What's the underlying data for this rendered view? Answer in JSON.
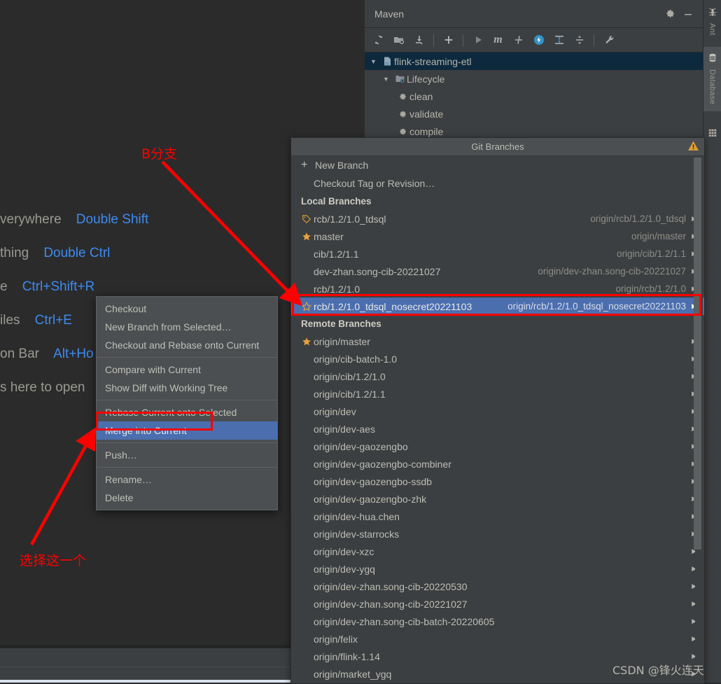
{
  "editor": {
    "hints": [
      {
        "label": "verywhere",
        "key": "Double Shift"
      },
      {
        "label": "thing",
        "key": "Double Ctrl"
      },
      {
        "label": "e",
        "key": "Ctrl+Shift+R"
      },
      {
        "label": "iles",
        "key": "Ctrl+E"
      },
      {
        "label": "on Bar",
        "key": "Alt+Ho"
      },
      {
        "label": "s here to open",
        "key": ""
      }
    ]
  },
  "maven": {
    "title": "Maven",
    "header_buttons": [
      {
        "name": "settings",
        "glyph": "⚙"
      },
      {
        "name": "hide",
        "glyph": "—"
      }
    ],
    "toolbar": [
      {
        "name": "reload-all-maven-projects-icon",
        "glyph": "↻"
      },
      {
        "name": "generate-sources-icon",
        "glyph": "◱"
      },
      {
        "name": "download-sources-icon",
        "glyph": "⤓"
      },
      {
        "name": "separator",
        "glyph": ""
      },
      {
        "name": "add-maven-project-icon",
        "glyph": "+"
      },
      {
        "name": "separator",
        "glyph": ""
      },
      {
        "name": "run-icon",
        "glyph": "▶"
      },
      {
        "name": "execute-maven-goal-icon",
        "glyph": "m"
      },
      {
        "name": "toggle-skip-tests-icon",
        "glyph": "∤"
      },
      {
        "name": "toggle-offline-mode-icon",
        "glyph": "⚡"
      },
      {
        "name": "expand-all-icon",
        "glyph": "⇕"
      },
      {
        "name": "collapse-all-icon",
        "glyph": "↕"
      },
      {
        "name": "separator",
        "glyph": ""
      },
      {
        "name": "maven-settings-icon",
        "glyph": "🔧"
      }
    ],
    "tree": [
      {
        "label": "flink-streaming-etl",
        "indent": 0,
        "selected": true,
        "triangle": "▼",
        "icon": "maven-module-icon"
      },
      {
        "label": "Lifecycle",
        "indent": 1,
        "selected": false,
        "triangle": "▼",
        "icon": "lifecycle-folder-icon"
      },
      {
        "label": "clean",
        "indent": 2,
        "selected": false,
        "triangle": "",
        "icon": "gear-icon"
      },
      {
        "label": "validate",
        "indent": 2,
        "selected": false,
        "triangle": "",
        "icon": "gear-icon"
      },
      {
        "label": "compile",
        "indent": 2,
        "selected": false,
        "triangle": "",
        "icon": "gear-icon"
      }
    ]
  },
  "tool_strip": [
    {
      "label": "Ant",
      "icon": "ant-icon",
      "active": false
    },
    {
      "label": "Database",
      "icon": "database-icon",
      "active": true
    },
    {
      "label": "",
      "icon": "grid-icon",
      "active": false
    }
  ],
  "git_branches": {
    "title": "Git Branches",
    "warning_icon": "warning-triangle-icon",
    "actions": [
      {
        "label": "New Branch",
        "icon": "plus-icon"
      },
      {
        "label": "Checkout Tag or Revision…",
        "icon": ""
      }
    ],
    "local_section": "Local Branches",
    "local": [
      {
        "name": "rcb/1.2/1.0_tdsql",
        "tracking": "origin/rcb/1.2/1.0_tdsql",
        "icon": "tag-icon",
        "selected": false
      },
      {
        "name": "master",
        "tracking": "origin/master",
        "icon": "star-filled-icon",
        "selected": false
      },
      {
        "name": "cib/1.2/1.1",
        "tracking": "origin/cib/1.2/1.1",
        "icon": "",
        "selected": false
      },
      {
        "name": "dev-zhan.song-cib-20221027",
        "tracking": "origin/dev-zhan.song-cib-20221027",
        "icon": "",
        "selected": false
      },
      {
        "name": "rcb/1.2/1.0",
        "tracking": "origin/rcb/1.2/1.0",
        "icon": "",
        "selected": false
      },
      {
        "name": "rcb/1.2/1.0_tdsql_nosecret20221103",
        "tracking": "origin/rcb/1.2/1.0_tdsql_nosecret20221103",
        "icon": "star-outline-icon",
        "selected": true
      }
    ],
    "remote_section": "Remote Branches",
    "remote": [
      {
        "name": "origin/master",
        "icon": "star-filled-icon"
      },
      {
        "name": "origin/cib-batch-1.0",
        "icon": ""
      },
      {
        "name": "origin/cib/1.2/1.0",
        "icon": ""
      },
      {
        "name": "origin/cib/1.2/1.1",
        "icon": ""
      },
      {
        "name": "origin/dev",
        "icon": ""
      },
      {
        "name": "origin/dev-aes",
        "icon": ""
      },
      {
        "name": "origin/dev-gaozengbo",
        "icon": ""
      },
      {
        "name": "origin/dev-gaozengbo-combiner",
        "icon": ""
      },
      {
        "name": "origin/dev-gaozengbo-ssdb",
        "icon": ""
      },
      {
        "name": "origin/dev-gaozengbo-zhk",
        "icon": ""
      },
      {
        "name": "origin/dev-hua.chen",
        "icon": ""
      },
      {
        "name": "origin/dev-starrocks",
        "icon": ""
      },
      {
        "name": "origin/dev-xzc",
        "icon": ""
      },
      {
        "name": "origin/dev-ygq",
        "icon": ""
      },
      {
        "name": "origin/dev-zhan.song-cib-20220530",
        "icon": ""
      },
      {
        "name": "origin/dev-zhan.song-cib-20221027",
        "icon": ""
      },
      {
        "name": "origin/dev-zhan.song-cib-batch-20220605",
        "icon": ""
      },
      {
        "name": "origin/felix",
        "icon": ""
      },
      {
        "name": "origin/flink-1.14",
        "icon": ""
      },
      {
        "name": "origin/market_ygq",
        "icon": ""
      }
    ]
  },
  "context_menu": [
    {
      "label": "Checkout",
      "type": "item",
      "selected": false
    },
    {
      "label": "New Branch from Selected…",
      "type": "item",
      "selected": false
    },
    {
      "label": "Checkout and Rebase onto Current",
      "type": "item",
      "selected": false
    },
    {
      "label": "",
      "type": "separator",
      "selected": false
    },
    {
      "label": "Compare with Current",
      "type": "item",
      "selected": false
    },
    {
      "label": "Show Diff with Working Tree",
      "type": "item",
      "selected": false
    },
    {
      "label": "",
      "type": "separator",
      "selected": false
    },
    {
      "label": "Rebase Current onto Selected",
      "type": "item",
      "selected": false
    },
    {
      "label": "Merge into Current",
      "type": "item",
      "selected": true
    },
    {
      "label": "",
      "type": "separator",
      "selected": false
    },
    {
      "label": "Push…",
      "type": "item",
      "selected": false
    },
    {
      "label": "",
      "type": "separator",
      "selected": false
    },
    {
      "label": "Rename…",
      "type": "item",
      "selected": false
    },
    {
      "label": "Delete",
      "type": "item",
      "selected": false
    }
  ],
  "annotations": {
    "branch_label": "B分支",
    "pick_label": "选择这一个",
    "color": "#ff0000"
  },
  "watermark": "CSDN @锋火连天"
}
